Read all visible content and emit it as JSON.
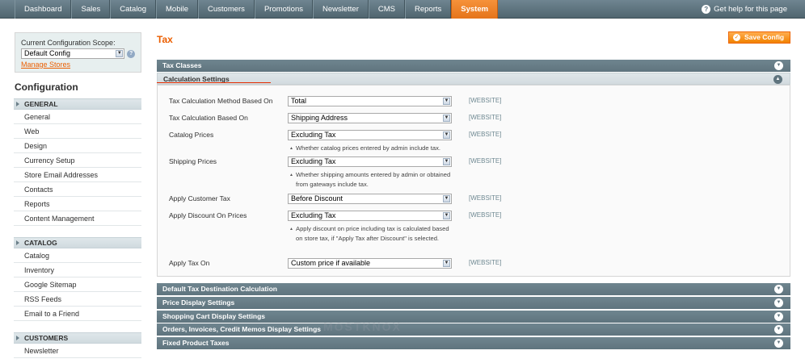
{
  "nav": {
    "items": [
      "Dashboard",
      "Sales",
      "Catalog",
      "Mobile",
      "Customers",
      "Promotions",
      "Newsletter",
      "CMS",
      "Reports",
      "System"
    ],
    "help": "Get help for this page"
  },
  "sidebar": {
    "scope_label": "Current Configuration Scope:",
    "scope_value": "Default Config",
    "manage_stores": "Manage Stores",
    "title": "Configuration",
    "groups": [
      {
        "head": "GENERAL",
        "items": [
          "General",
          "Web",
          "Design",
          "Currency Setup",
          "Store Email Addresses",
          "Contacts",
          "Reports",
          "Content Management"
        ]
      },
      {
        "head": "CATALOG",
        "items": [
          "Catalog",
          "Inventory",
          "Google Sitemap",
          "RSS Feeds",
          "Email to a Friend"
        ]
      },
      {
        "head": "CUSTOMERS",
        "items": [
          "Newsletter"
        ]
      }
    ]
  },
  "main": {
    "title": "Tax",
    "save_label": "Save Config",
    "sections": {
      "tax_classes": "Tax Classes",
      "calculation": "Calculation Settings",
      "default_dest": "Default Tax Destination Calculation",
      "price_display": "Price Display Settings",
      "cart_display": "Shopping Cart Display Settings",
      "orders_display": "Orders, Invoices, Credit Memos Display Settings",
      "fpt": "Fixed Product Taxes"
    },
    "fields": [
      {
        "label": "Tax Calculation Method Based On",
        "value": "Total",
        "scope": "[WEBSITE]",
        "note": ""
      },
      {
        "label": "Tax Calculation Based On",
        "value": "Shipping Address",
        "scope": "[WEBSITE]",
        "note": ""
      },
      {
        "label": "Catalog Prices",
        "value": "Excluding Tax",
        "scope": "[WEBSITE]",
        "note": "Whether catalog prices entered by admin include tax."
      },
      {
        "label": "Shipping Prices",
        "value": "Excluding Tax",
        "scope": "[WEBSITE]",
        "note": "Whether shipping amounts entered by admin or obtained from gateways include tax."
      },
      {
        "label": "Apply Customer Tax",
        "value": "Before Discount",
        "scope": "[WEBSITE]",
        "note": ""
      },
      {
        "label": "Apply Discount On Prices",
        "value": "Excluding Tax",
        "scope": "[WEBSITE]",
        "note": "Apply discount on price including tax is calculated based on store tax, if \"Apply Tax after Discount\" is selected."
      },
      {
        "label": "Apply Tax On",
        "value": "Custom price if available",
        "scope": "[WEBSITE]",
        "note": ""
      }
    ]
  },
  "watermark": "MOSTKNOX"
}
